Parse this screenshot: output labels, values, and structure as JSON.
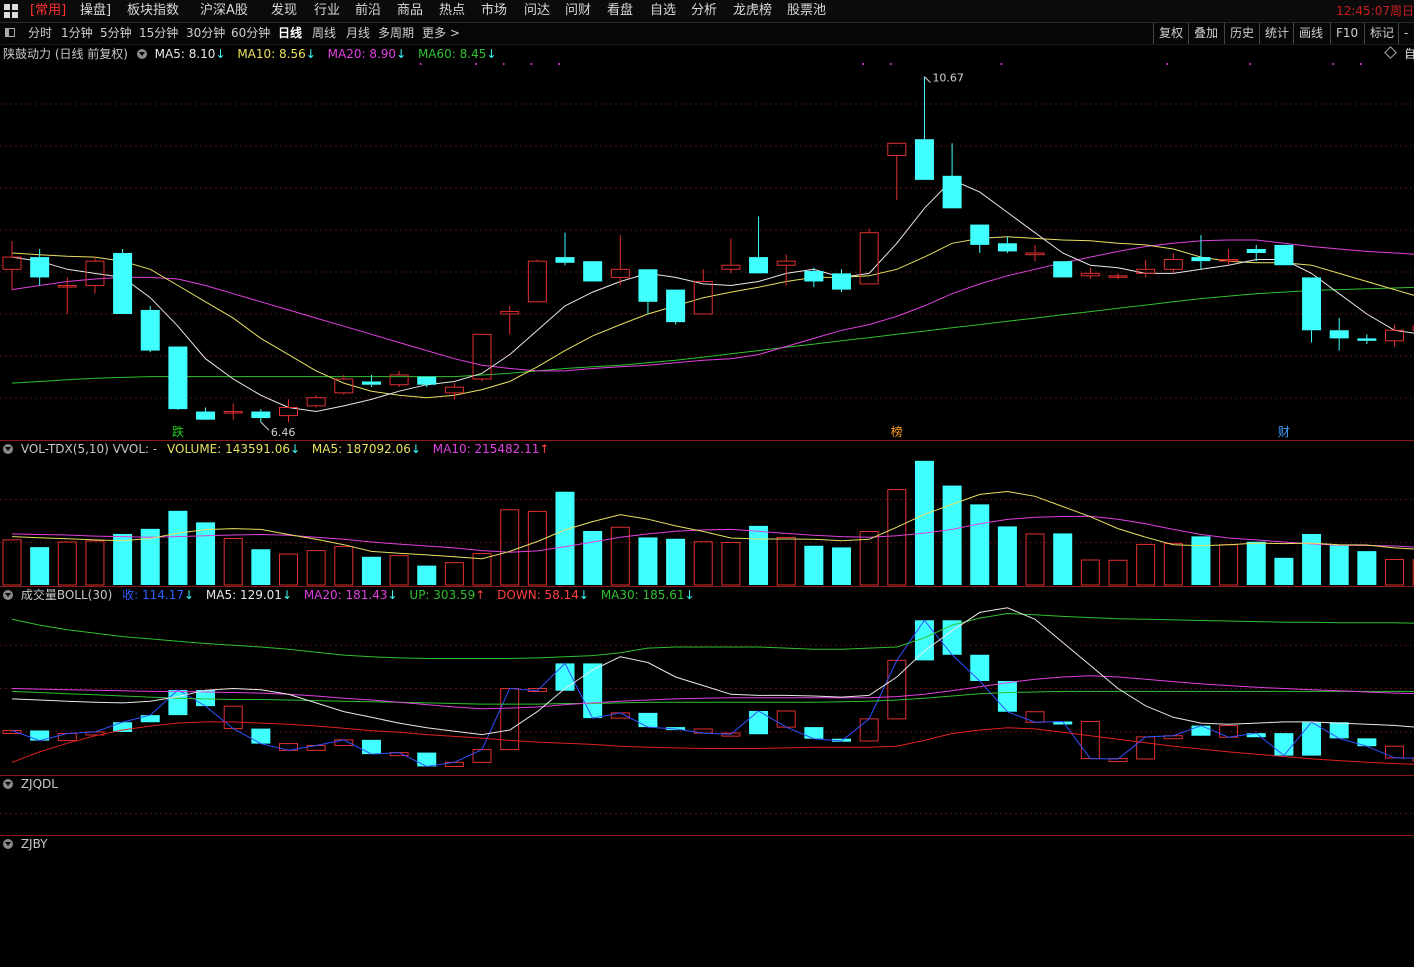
{
  "menubar": {
    "items": [
      "[常用]",
      "操盘]",
      "板块指数",
      "沪深A股",
      "发现",
      "行业",
      "前沿",
      "商品",
      "热点",
      "市场",
      "问达",
      "问财",
      "看盘",
      "自选",
      "分析",
      "龙虎榜",
      "股票池"
    ],
    "clock": "12:45:07",
    "clock_tail": "周日"
  },
  "toolbar": {
    "periods": [
      "分时",
      "1分钟",
      "5分钟",
      "15分钟",
      "30分钟",
      "60分钟",
      "日线",
      "周线",
      "月线",
      "多周期",
      "更多 >"
    ],
    "active": "日线",
    "right": [
      "复权",
      "叠加",
      "历史",
      "统计",
      "画线",
      "F10",
      "标记",
      "-自"
    ]
  },
  "price_pane": {
    "title": "陕鼓动力 (日线 前复权)",
    "ma5": "MA5: 8.10",
    "ma10": "MA10: 8.56",
    "ma20": "MA20: 8.90",
    "ma60": "MA60: 8.45",
    "high_label": "10.67",
    "low_label": "6.46",
    "markers": [
      {
        "text": "跌",
        "color": "#20d020"
      },
      {
        "text": "榜",
        "color": "#ffa020"
      },
      {
        "text": "财",
        "color": "#40a0ff"
      }
    ],
    "colors": {
      "ma5": "#e8e8e8",
      "ma10": "#e8e060",
      "ma20": "#e040e0",
      "ma60": "#30c030",
      "up": "#e03030",
      "down": "#40ffff"
    }
  },
  "vol_pane": {
    "title": "VOL-TDX(5,10) VVOL: -",
    "volume": "VOLUME: 143591.06",
    "ma5": "MA5: 187092.06",
    "ma10": "MA10: 215482.11"
  },
  "boll_pane": {
    "title": "成交量BOLL(30)",
    "vol": "收: 114.17",
    "ma5": "MA5: 129.01",
    "ma20": "MA20: 181.43",
    "up": "UP: 303.59",
    "down": "DOWN: 58.14",
    "ma30": "MA30: 185.61"
  },
  "zjqdl_pane": {
    "title": "ZJQDL"
  },
  "zjby_pane": {
    "title": "ZJBY"
  },
  "chart_data": {
    "type": "candlestick",
    "candles": [
      {
        "o": 8.3,
        "h": 8.65,
        "l": 8.05,
        "c": 8.45
      },
      {
        "o": 8.45,
        "h": 8.55,
        "l": 8.1,
        "c": 8.2
      },
      {
        "o": 8.1,
        "h": 8.2,
        "l": 7.75,
        "c": 8.1
      },
      {
        "o": 8.1,
        "h": 8.45,
        "l": 8.0,
        "c": 8.4
      },
      {
        "o": 8.5,
        "h": 8.55,
        "l": 7.75,
        "c": 7.75
      },
      {
        "o": 7.8,
        "h": 7.85,
        "l": 7.28,
        "c": 7.3
      },
      {
        "o": 7.35,
        "h": 7.35,
        "l": 6.57,
        "c": 6.58
      },
      {
        "o": 6.55,
        "h": 6.6,
        "l": 6.46,
        "c": 6.45
      },
      {
        "o": 6.55,
        "h": 6.65,
        "l": 6.45,
        "c": 6.55
      },
      {
        "o": 6.55,
        "h": 6.58,
        "l": 6.42,
        "c": 6.47
      },
      {
        "o": 6.5,
        "h": 6.7,
        "l": 6.42,
        "c": 6.6
      },
      {
        "o": 6.62,
        "h": 6.75,
        "l": 6.6,
        "c": 6.72
      },
      {
        "o": 6.78,
        "h": 7.0,
        "l": 6.76,
        "c": 6.95
      },
      {
        "o": 6.92,
        "h": 7.0,
        "l": 6.85,
        "c": 6.88
      },
      {
        "o": 6.88,
        "h": 7.05,
        "l": 6.85,
        "c": 7.0
      },
      {
        "o": 6.98,
        "h": 6.98,
        "l": 6.85,
        "c": 6.88
      },
      {
        "o": 6.78,
        "h": 6.9,
        "l": 6.7,
        "c": 6.85
      },
      {
        "o": 6.95,
        "h": 7.5,
        "l": 6.92,
        "c": 7.5
      },
      {
        "o": 7.75,
        "h": 7.85,
        "l": 7.5,
        "c": 7.78
      },
      {
        "o": 7.9,
        "h": 8.42,
        "l": 7.9,
        "c": 8.4
      },
      {
        "o": 8.45,
        "h": 8.75,
        "l": 8.35,
        "c": 8.38
      },
      {
        "o": 8.4,
        "h": 8.4,
        "l": 8.15,
        "c": 8.15
      },
      {
        "o": 8.2,
        "h": 8.72,
        "l": 8.1,
        "c": 8.3
      },
      {
        "o": 8.3,
        "h": 8.3,
        "l": 7.75,
        "c": 7.9
      },
      {
        "o": 8.05,
        "h": 8.05,
        "l": 7.62,
        "c": 7.65
      },
      {
        "o": 7.75,
        "h": 8.3,
        "l": 7.75,
        "c": 8.15
      },
      {
        "o": 8.3,
        "h": 8.68,
        "l": 8.25,
        "c": 8.35
      },
      {
        "o": 8.45,
        "h": 8.95,
        "l": 8.25,
        "c": 8.25
      },
      {
        "o": 8.35,
        "h": 8.48,
        "l": 8.1,
        "c": 8.4
      },
      {
        "o": 8.28,
        "h": 8.32,
        "l": 8.08,
        "c": 8.15
      },
      {
        "o": 8.25,
        "h": 8.3,
        "l": 8.02,
        "c": 8.05
      },
      {
        "o": 8.12,
        "h": 8.8,
        "l": 8.12,
        "c": 8.75
      },
      {
        "o": 9.7,
        "h": 9.85,
        "l": 9.15,
        "c": 9.85
      },
      {
        "o": 9.9,
        "h": 10.67,
        "l": 9.4,
        "c": 9.4
      },
      {
        "o": 9.45,
        "h": 9.85,
        "l": 9.05,
        "c": 9.05
      },
      {
        "o": 8.85,
        "h": 8.85,
        "l": 8.5,
        "c": 8.6
      },
      {
        "o": 8.62,
        "h": 8.7,
        "l": 8.5,
        "c": 8.52
      },
      {
        "o": 8.48,
        "h": 8.6,
        "l": 8.4,
        "c": 8.5
      },
      {
        "o": 8.4,
        "h": 8.4,
        "l": 8.2,
        "c": 8.2
      },
      {
        "o": 8.22,
        "h": 8.32,
        "l": 8.18,
        "c": 8.25
      },
      {
        "o": 8.22,
        "h": 8.25,
        "l": 8.18,
        "c": 8.22
      },
      {
        "o": 8.25,
        "h": 8.42,
        "l": 8.2,
        "c": 8.3
      },
      {
        "o": 8.3,
        "h": 8.5,
        "l": 8.25,
        "c": 8.42
      },
      {
        "o": 8.45,
        "h": 8.72,
        "l": 8.3,
        "c": 8.4
      },
      {
        "o": 8.42,
        "h": 8.55,
        "l": 8.35,
        "c": 8.42
      },
      {
        "o": 8.55,
        "h": 8.6,
        "l": 8.4,
        "c": 8.5
      },
      {
        "o": 8.6,
        "h": 8.6,
        "l": 8.35,
        "c": 8.35
      },
      {
        "o": 8.2,
        "h": 8.2,
        "l": 7.4,
        "c": 7.55
      },
      {
        "o": 7.55,
        "h": 7.7,
        "l": 7.3,
        "c": 7.45
      },
      {
        "o": 7.45,
        "h": 7.5,
        "l": 7.38,
        "c": 7.42
      },
      {
        "o": 7.42,
        "h": 7.62,
        "l": 7.35,
        "c": 7.55
      },
      {
        "o": 7.55,
        "h": 7.65,
        "l": 7.5,
        "c": 7.6
      }
    ],
    "ma5": [
      8.45,
      8.4,
      8.3,
      8.25,
      8.2,
      7.95,
      7.6,
      7.2,
      6.95,
      6.75,
      6.6,
      6.55,
      6.62,
      6.7,
      6.8,
      6.88,
      6.92,
      7.02,
      7.25,
      7.55,
      7.85,
      8.02,
      8.15,
      8.25,
      8.2,
      8.12,
      8.1,
      8.15,
      8.25,
      8.3,
      8.2,
      8.25,
      8.62,
      9.05,
      9.4,
      9.25,
      9.0,
      8.75,
      8.5,
      8.35,
      8.32,
      8.25,
      8.25,
      8.3,
      8.35,
      8.42,
      8.42,
      8.25,
      8.0,
      7.75,
      7.55,
      7.5
    ],
    "ma10": [
      8.5,
      8.48,
      8.46,
      8.45,
      8.4,
      8.3,
      8.1,
      7.9,
      7.7,
      7.45,
      7.25,
      7.05,
      6.9,
      6.8,
      6.75,
      6.72,
      6.75,
      6.82,
      6.92,
      7.1,
      7.3,
      7.48,
      7.62,
      7.75,
      7.85,
      7.95,
      8.02,
      8.08,
      8.15,
      8.2,
      8.2,
      8.22,
      8.3,
      8.45,
      8.62,
      8.68,
      8.7,
      8.68,
      8.66,
      8.65,
      8.62,
      8.6,
      8.55,
      8.45,
      8.4,
      8.38,
      8.38,
      8.35,
      8.25,
      8.15,
      8.05,
      7.95
    ],
    "ma20": [
      8.05,
      8.1,
      8.15,
      8.18,
      8.2,
      8.2,
      8.18,
      8.1,
      8.0,
      7.9,
      7.8,
      7.7,
      7.6,
      7.5,
      7.4,
      7.3,
      7.2,
      7.12,
      7.08,
      7.05,
      7.05,
      7.08,
      7.1,
      7.12,
      7.15,
      7.18,
      7.2,
      7.25,
      7.35,
      7.45,
      7.55,
      7.62,
      7.72,
      7.85,
      8.0,
      8.12,
      8.22,
      8.3,
      8.38,
      8.45,
      8.52,
      8.58,
      8.62,
      8.65,
      8.66,
      8.66,
      8.62,
      8.58,
      8.55,
      8.52,
      8.5,
      8.48
    ],
    "ma60": [
      6.9,
      6.92,
      6.94,
      6.96,
      6.97,
      6.98,
      6.98,
      6.98,
      6.98,
      6.98,
      6.98,
      6.98,
      6.98,
      6.98,
      6.98,
      6.98,
      6.98,
      7.0,
      7.02,
      7.05,
      7.08,
      7.1,
      7.12,
      7.15,
      7.18,
      7.22,
      7.26,
      7.3,
      7.34,
      7.38,
      7.42,
      7.46,
      7.5,
      7.54,
      7.58,
      7.62,
      7.66,
      7.7,
      7.74,
      7.78,
      7.82,
      7.86,
      7.9,
      7.94,
      7.97,
      8.0,
      8.02,
      8.04,
      8.05,
      8.06,
      8.07,
      8.08
    ],
    "volume": [
      168000,
      141000,
      160000,
      164000,
      190000,
      209000,
      276000,
      233000,
      173000,
      133000,
      115000,
      128000,
      143000,
      105000,
      109000,
      72000,
      83000,
      117000,
      280000,
      274000,
      347000,
      201000,
      215000,
      177000,
      172000,
      161000,
      158000,
      220000,
      177000,
      146000,
      140000,
      199000,
      355000,
      462000,
      370000,
      300000,
      218000,
      190000,
      192000,
      93000,
      92000,
      151000,
      154000,
      181000,
      150000,
      161000,
      101000,
      190000,
      147000,
      126000,
      95000,
      94000
    ],
    "vol_ma5": [
      180000,
      176000,
      172000,
      168000,
      165000,
      173000,
      193000,
      206000,
      210000,
      207000,
      188000,
      170000,
      150000,
      125000,
      118000,
      112000,
      105000,
      98000,
      125000,
      162000,
      205000,
      236000,
      262000,
      245000,
      220000,
      199000,
      175000,
      171000,
      171000,
      170000,
      165000,
      170000,
      215000,
      263000,
      300000,
      337000,
      348000,
      330000,
      292000,
      254000,
      210000,
      178000,
      150000,
      146000,
      150000,
      156000,
      154000,
      156000,
      150000,
      149000,
      138000,
      132000
    ],
    "vol_ma10": [
      190000,
      188000,
      186000,
      182000,
      180000,
      178000,
      180000,
      183000,
      186000,
      188000,
      185000,
      178000,
      170000,
      160000,
      152000,
      145000,
      138000,
      128000,
      122000,
      127000,
      142000,
      160000,
      178000,
      190000,
      200000,
      205000,
      207000,
      200000,
      192000,
      185000,
      180000,
      178000,
      183000,
      193000,
      207000,
      228000,
      244000,
      252000,
      255000,
      256000,
      245000,
      228000,
      207000,
      188000,
      175000,
      168000,
      160000,
      153000,
      148000,
      147000,
      145000,
      140000
    ],
    "boll": {
      "mid": [
        185,
        183,
        181,
        179,
        177,
        175,
        173,
        172,
        171,
        171,
        170,
        169,
        168,
        167,
        166,
        165,
        164,
        163,
        163,
        163,
        164,
        164,
        165,
        166,
        166,
        166,
        166,
        166,
        166,
        166,
        167,
        168,
        170,
        173,
        177,
        181,
        183,
        184,
        185,
        185,
        185,
        185,
        185,
        185,
        185,
        185,
        185,
        185,
        185,
        185,
        185,
        185
      ],
      "up": [
        310,
        300,
        292,
        286,
        280,
        276,
        272,
        268,
        265,
        262,
        258,
        253,
        248,
        245,
        243,
        242,
        242,
        242,
        242,
        243,
        245,
        247,
        252,
        260,
        262,
        262,
        262,
        262,
        260,
        258,
        258,
        260,
        262,
        278,
        300,
        312,
        320,
        318,
        315,
        313,
        311,
        310,
        309,
        308,
        307,
        306,
        305,
        305,
        304,
        304,
        304,
        303
      ],
      "down": [
        62,
        80,
        95,
        108,
        118,
        125,
        130,
        132,
        132,
        130,
        128,
        125,
        121,
        117,
        114,
        110,
        107,
        104,
        100,
        97,
        95,
        93,
        90,
        88,
        87,
        86,
        86,
        86,
        87,
        88,
        88,
        88,
        90,
        100,
        112,
        118,
        122,
        120,
        114,
        108,
        102,
        96,
        90,
        85,
        80,
        76,
        72,
        68,
        65,
        62,
        60,
        58
      ],
      "ma5": [
        172,
        170,
        168,
        166,
        165,
        168,
        176,
        187,
        190,
        188,
        180,
        165,
        150,
        140,
        130,
        122,
        116,
        110,
        118,
        150,
        190,
        222,
        245,
        235,
        210,
        195,
        180,
        178,
        178,
        177,
        175,
        178,
        210,
        255,
        290,
        322,
        330,
        310,
        270,
        230,
        190,
        160,
        140,
        130,
        128,
        130,
        132,
        132,
        130,
        128,
        126,
        122
      ],
      "ma20": [
        190,
        189,
        188,
        187,
        186,
        185,
        185,
        184,
        183,
        182,
        180,
        177,
        173,
        170,
        166,
        162,
        158,
        155,
        156,
        158,
        162,
        165,
        168,
        170,
        172,
        173,
        174,
        174,
        174,
        174,
        174,
        174,
        176,
        180,
        186,
        193,
        200,
        206,
        210,
        212,
        210,
        206,
        202,
        198,
        195,
        192,
        190,
        188,
        186,
        184,
        182,
        181
      ]
    }
  }
}
